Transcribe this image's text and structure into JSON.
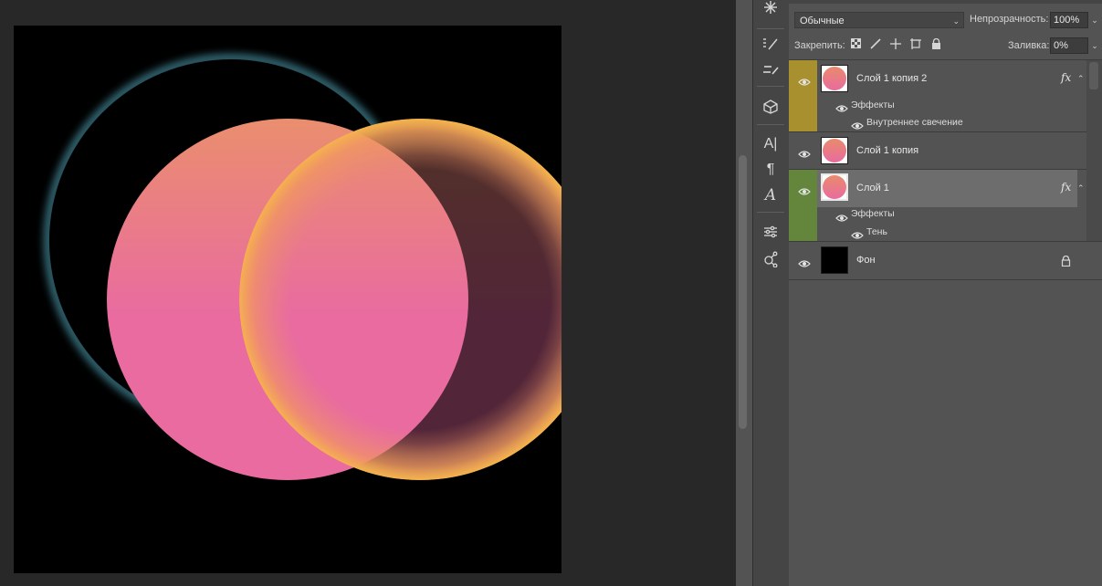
{
  "toolbar_icons": [
    "snowflake-icon",
    "brush-list-icon",
    "brush-icon",
    "sliders-icon",
    "cube-icon",
    "character-icon",
    "paragraph-icon",
    "glyph-icon",
    "adjustments-icon",
    "network-icon"
  ],
  "layers_panel": {
    "blend_mode": "Обычные",
    "opacity_label": "Непрозрачность:",
    "opacity_value": "100%",
    "lock_label": "Закрепить:",
    "fill_label": "Заливка:",
    "fill_value": "0%",
    "layers": [
      {
        "name": "Слой 1 копия 2",
        "color": "#a8902e",
        "effects_label": "Эффекты",
        "effect_name": "Внутреннее свечение",
        "fx": "fx"
      },
      {
        "name": "Слой 1 копия"
      },
      {
        "name": "Слой 1",
        "color": "#63863c",
        "effects_label": "Эффекты",
        "effect_name": "Тень",
        "fx": "fx"
      },
      {
        "name": "Фон"
      }
    ]
  },
  "colors": {
    "cyan_glow": "#6ad7f0",
    "yellow_glow": "#b2a52a",
    "pink": "#e96ba0",
    "salmon": "#ea8e6e",
    "orange": "#f4a950"
  }
}
